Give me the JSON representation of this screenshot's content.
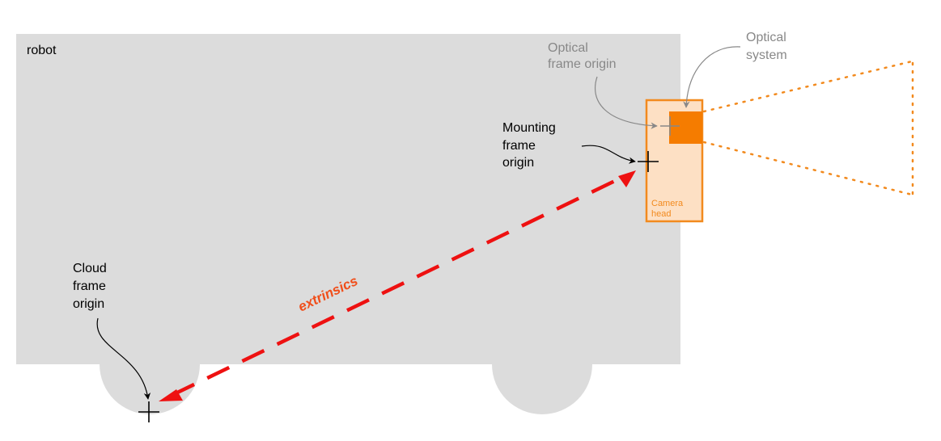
{
  "labels": {
    "robot": "robot",
    "optical_frame_origin": [
      "Optical",
      "frame origin"
    ],
    "optical_system": [
      "Optical",
      "system"
    ],
    "mounting_frame_origin": [
      "Mounting",
      "frame",
      "origin"
    ],
    "camera_head": [
      "Camera",
      "head"
    ],
    "cloud_frame_origin": [
      "Cloud",
      "frame",
      "origin"
    ],
    "extrinsics": "extrinsics"
  },
  "colors": {
    "robot_body": "#dcdcdc",
    "camera": "#f28a1e",
    "camera_fill": "#fde0c4",
    "optical_system": "#f57c00",
    "extrinsics": "#ee1111",
    "extrinsics_label": "#f04e1a",
    "grey_text": "#888888",
    "text": "#000000"
  }
}
